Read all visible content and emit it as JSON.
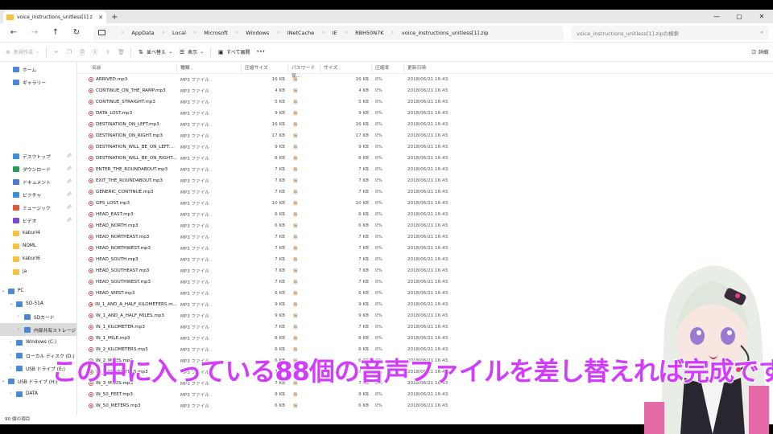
{
  "window": {
    "tab_label": "voice_instructions_unitless[1].z",
    "new_tab": "+",
    "controls": [
      "—",
      "▢",
      "✕"
    ]
  },
  "address": {
    "breadcrumbs": [
      "AppData",
      "Local",
      "Microsoft",
      "Windows",
      "INetCache",
      "IE",
      "RBH50N7K",
      "voice_instructions_unitless[1].zip"
    ],
    "search_placeholder": "voice_instructions_unitless[1].zipの検索"
  },
  "commands": {
    "new": "新規作成",
    "sort": "並べ替え",
    "view": "表示",
    "extract_all": "すべて展開",
    "more": "•••",
    "details": "詳細"
  },
  "sidebar": {
    "quick": [
      {
        "label": "ホーム",
        "icon": "home-icon"
      },
      {
        "label": "ギャラリー",
        "icon": "gallery-icon"
      }
    ],
    "pinned": [
      {
        "label": "デスクトップ",
        "icon": "desktop-icon",
        "color": "#3a8fd6"
      },
      {
        "label": "ダウンロード",
        "icon": "download-icon",
        "color": "#2b9a5a"
      },
      {
        "label": "ドキュメント",
        "icon": "documents-icon",
        "color": "#4a7bd0"
      },
      {
        "label": "ピクチャ",
        "icon": "pictures-icon",
        "color": "#3a8fd6"
      },
      {
        "label": "ミュージック",
        "icon": "music-icon",
        "color": "#e05a3a"
      },
      {
        "label": "ビデオ",
        "icon": "videos-icon",
        "color": "#7a4ad0"
      },
      {
        "label": "kaburi4",
        "icon": "folder-icon",
        "color": "#f4c243"
      },
      {
        "label": "NOML",
        "icon": "folder-icon",
        "color": "#f4c243"
      },
      {
        "label": "kaburi6",
        "icon": "folder-icon",
        "color": "#f4c243"
      },
      {
        "label": "ja",
        "icon": "folder-icon",
        "color": "#f4c243"
      }
    ],
    "tree": [
      {
        "label": "PC",
        "icon": "pc-icon",
        "indent": 0
      },
      {
        "label": "SO-51A",
        "icon": "phone-icon",
        "indent": 1
      },
      {
        "label": "SDカード",
        "icon": "drive-icon",
        "indent": 2
      },
      {
        "label": "内部共有ストレージ",
        "icon": "drive-icon",
        "indent": 2,
        "selected": true
      },
      {
        "label": "Windows (C:)",
        "icon": "drive-icon",
        "indent": 1
      },
      {
        "label": "ローカル ディスク (D:)",
        "icon": "drive-icon",
        "indent": 1
      },
      {
        "label": "USB ドライブ (E:)",
        "icon": "usb-icon",
        "indent": 1
      },
      {
        "label": "USB ドライブ (H:)",
        "icon": "usb-icon",
        "indent": 0
      },
      {
        "label": "DATA",
        "icon": "folder-icon",
        "indent": 1
      }
    ]
  },
  "columns": [
    "名前",
    "種類",
    "圧縮サイズ",
    "パスワード保...",
    "サイズ",
    "圧縮率",
    "更新日時"
  ],
  "files": [
    {
      "name": "ARRIVED.mp3",
      "csize": "16 KB",
      "size": "16 KB"
    },
    {
      "name": "CONTINUE_ON_THE_RAMP.mp3",
      "csize": "4 KB",
      "size": "4 KB"
    },
    {
      "name": "CONTINUE_STRAIGHT.mp3",
      "csize": "5 KB",
      "size": "5 KB"
    },
    {
      "name": "DATA_LOST.mp3",
      "csize": "9 KB",
      "size": "9 KB"
    },
    {
      "name": "DESTINATION_ON_LEFT.mp3",
      "csize": "16 KB",
      "size": "16 KB"
    },
    {
      "name": "DESTINATION_ON_RIGHT.mp3",
      "csize": "17 KB",
      "size": "17 KB"
    },
    {
      "name": "DESTINATION_WILL_BE_ON_LEFT....",
      "csize": "9 KB",
      "size": "9 KB"
    },
    {
      "name": "DESTINATION_WILL_BE_ON_RIGHT...",
      "csize": "8 KB",
      "size": "8 KB"
    },
    {
      "name": "ENTER_THE_ROUNDABOUT.mp3",
      "csize": "7 KB",
      "size": "7 KB"
    },
    {
      "name": "EXIT_THE_ROUNDABOUT.mp3",
      "csize": "7 KB",
      "size": "7 KB"
    },
    {
      "name": "GENERIC_CONTINUE.mp3",
      "csize": "7 KB",
      "size": "7 KB"
    },
    {
      "name": "GPS_LOST.mp3",
      "csize": "10 KB",
      "size": "10 KB"
    },
    {
      "name": "HEAD_EAST.mp3",
      "csize": "6 KB",
      "size": "6 KB"
    },
    {
      "name": "HEAD_NORTH.mp3",
      "csize": "6 KB",
      "size": "6 KB"
    },
    {
      "name": "HEAD_NORTHEAST.mp3",
      "csize": "7 KB",
      "size": "7 KB"
    },
    {
      "name": "HEAD_NORTHWEST.mp3",
      "csize": "7 KB",
      "size": "7 KB"
    },
    {
      "name": "HEAD_SOUTH.mp3",
      "csize": "7 KB",
      "size": "7 KB"
    },
    {
      "name": "HEAD_SOUTHEAST.mp3",
      "csize": "7 KB",
      "size": "7 KB"
    },
    {
      "name": "HEAD_SOUTHWEST.mp3",
      "csize": "7 KB",
      "size": "7 KB"
    },
    {
      "name": "HEAD_WEST.mp3",
      "csize": "6 KB",
      "size": "6 KB"
    },
    {
      "name": "IN_1_AND_A_HALF_KILOMETERS.m...",
      "csize": "9 KB",
      "size": "9 KB"
    },
    {
      "name": "IN_1_AND_A_HALF_MILES.mp3",
      "csize": "9 KB",
      "size": "9 KB"
    },
    {
      "name": "IN_1_KILOMETER.mp3",
      "csize": "7 KB",
      "size": "7 KB"
    },
    {
      "name": "IN_1_MILE.mp3",
      "csize": "8 KB",
      "size": "8 KB"
    },
    {
      "name": "IN_2_KILOMETERS.mp3",
      "csize": "6 KB",
      "size": "6 KB"
    },
    {
      "name": "IN_2_MILES.mp3",
      "csize": "6 KB",
      "size": "6 KB"
    },
    {
      "name": "IN_3_KILOMETERS.mp3",
      "csize": "7 KB",
      "size": "7 KB"
    },
    {
      "name": "IN_3_MILES.mp3",
      "csize": "7 KB",
      "size": "7 KB"
    },
    {
      "name": "IN_50_FEET.mp3",
      "csize": "8 KB",
      "size": "8 KB"
    },
    {
      "name": "IN_50_METERS.mp3",
      "csize": "6 KB",
      "size": "6 KB"
    }
  ],
  "file_common": {
    "type": "MP3 ファイル",
    "password": "無",
    "ratio": "0%",
    "date": "2018/06/21 16:43"
  },
  "status": {
    "item_count": "90 個の項目"
  },
  "caption": "この中に入っている88個の音声ファイルを差し替えれば完成です"
}
